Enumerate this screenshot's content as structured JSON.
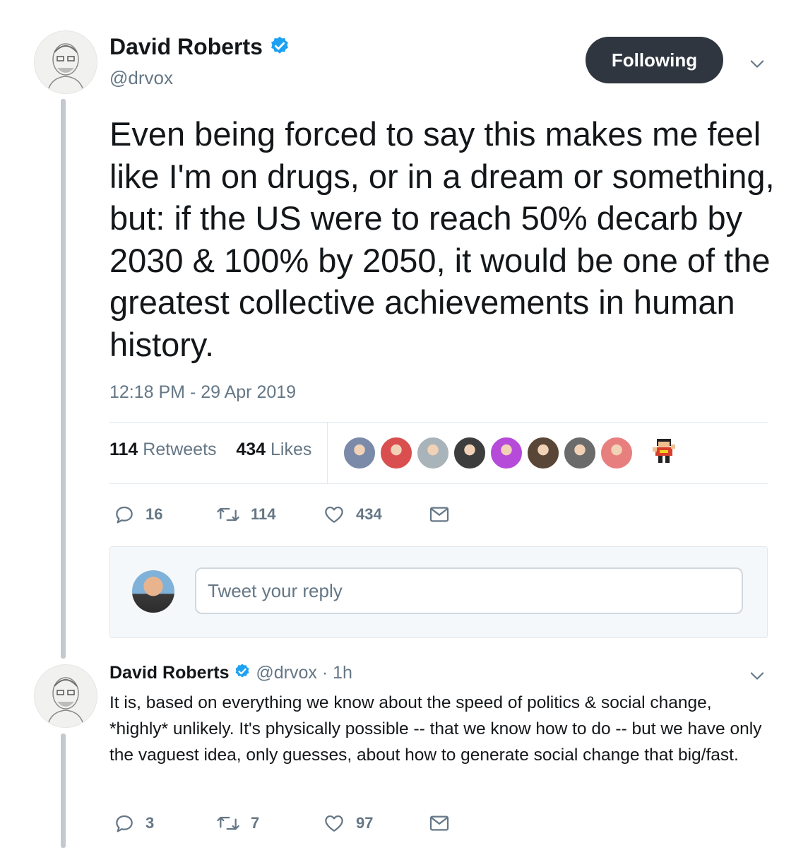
{
  "tweet": {
    "author_name": "David Roberts",
    "handle": "@drvox",
    "follow_label": "Following",
    "text": "Even being forced to say this makes me feel like I'm on drugs, or in a dream or something, but: if the US were to reach 50% decarb by 2030 & 100% by 2050, it would be one of the greatest collective achievements in human history.",
    "timestamp": "12:18 PM - 29 Apr 2019",
    "retweets_count": "114",
    "retweets_label": "Retweets",
    "likes_count": "434",
    "likes_label": "Likes",
    "actions": {
      "replies": "16",
      "retweets": "114",
      "likes": "434"
    }
  },
  "likers": [
    {
      "color": "#7a8aa8"
    },
    {
      "color": "#d94f4f"
    },
    {
      "color": "#a9b4ba"
    },
    {
      "color": "#3d3d3d"
    },
    {
      "color": "#b64ad9"
    },
    {
      "color": "#5a4636"
    },
    {
      "color": "#6b6b6b"
    },
    {
      "color": "#e77f7f"
    }
  ],
  "reply_composer": {
    "placeholder": "Tweet your reply"
  },
  "reply": {
    "author_name": "David Roberts",
    "handle": "@drvox",
    "separator": "·",
    "time": "1h",
    "text": "It is, based on everything we know about the speed of politics & social change, *highly* unlikely. It's physically possible -- that we know how to do -- but we have only the vaguest idea, only guesses, about how to generate social change that big/fast.",
    "actions": {
      "replies": "3",
      "retweets": "7",
      "likes": "97"
    }
  },
  "colors": {
    "accent": "#1da1f2",
    "muted": "#657786",
    "button_dark": "#2f3640"
  },
  "icons": [
    "verified-badge-icon",
    "chevron-down-icon",
    "reply-icon",
    "retweet-icon",
    "like-icon",
    "message-icon"
  ]
}
